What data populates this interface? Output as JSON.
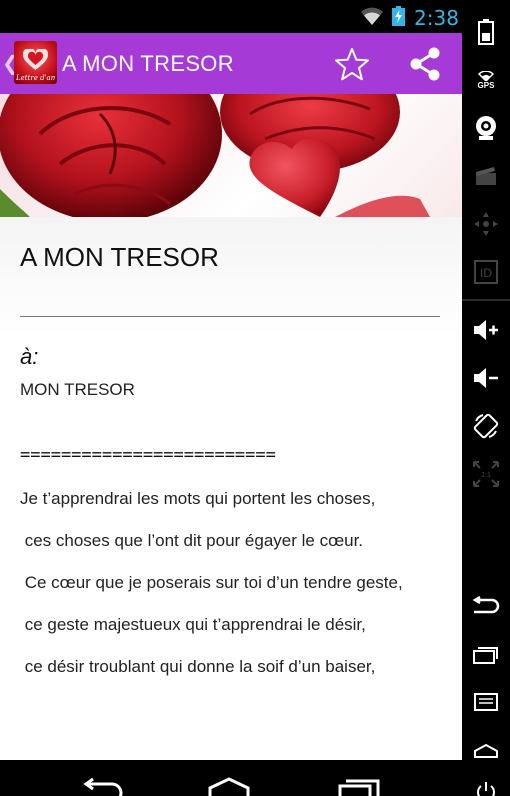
{
  "status_bar": {
    "time": "2:38",
    "icons": [
      "wifi-icon",
      "battery-charging-icon"
    ],
    "clock_color": "#33b5e5"
  },
  "action_bar": {
    "title": "A MON TRESOR",
    "app_icon_caption": "Lettre d'amour",
    "color": "#a53ad6",
    "actions": [
      "star-icon",
      "share-icon"
    ]
  },
  "article": {
    "title": "A MON TRESOR",
    "to_label": "à:",
    "recipient": "MON TRESOR",
    "separator": "=========================",
    "lines": [
      "Je t’apprendrai les mots qui portent les choses,",
      " ces choses que l’ont dit pour égayer le cœur.",
      " Ce cœur que je poserais sur toi d’un tendre geste,",
      " ce geste majestueux qui t’apprendrai le désir,",
      " ce désir troublant qui donne la soif d’un baiser,"
    ]
  },
  "side_nav": {
    "icons": [
      "battery-icon",
      "gps-icon",
      "camera-icon",
      "clapper-icon",
      "dpad-icon",
      "id-icon",
      "volume-up-icon",
      "volume-down-icon",
      "rotate-icon",
      "scale-icon",
      "back-icon",
      "recent-apps-icon",
      "menu-icon",
      "home-icon",
      "power-icon"
    ],
    "gps_label": "GPS"
  },
  "bottom_nav": {
    "icons": [
      "back-icon",
      "home-icon",
      "recent-apps-icon"
    ]
  }
}
